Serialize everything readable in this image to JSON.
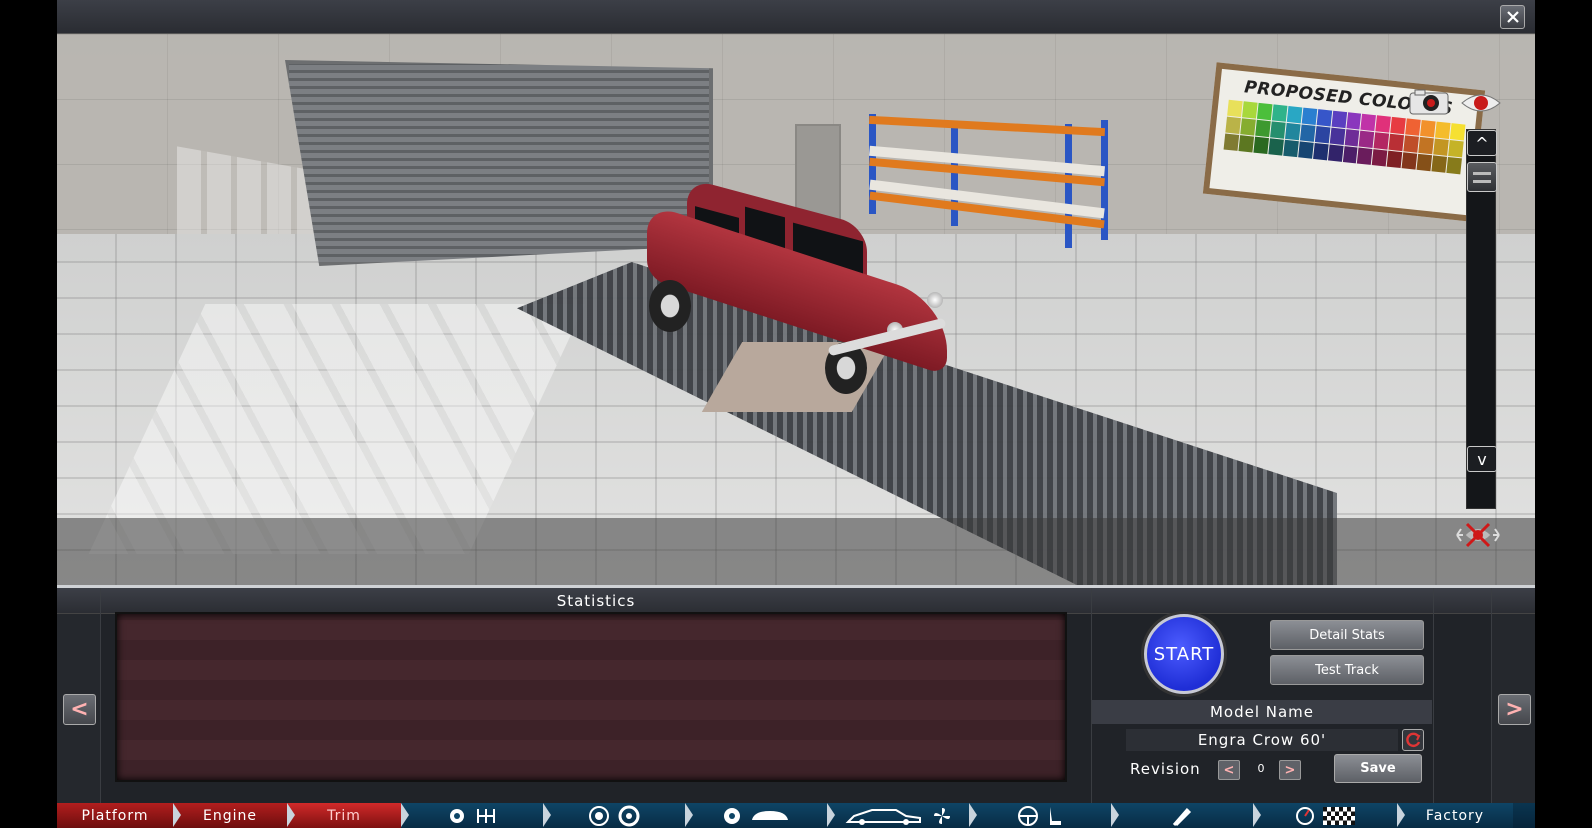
{
  "window": {
    "close_label": "✕"
  },
  "viewport": {
    "colour_board_title": "PROPOSED COLOURS",
    "scroll_up_label": "^",
    "scroll_down_label": "v",
    "swatch_colors": [
      "#e8e05a",
      "#a8d83c",
      "#4cbf3b",
      "#2fb38a",
      "#29a7c4",
      "#2a7fd0",
      "#3756c9",
      "#5a3fc0",
      "#8a37bd",
      "#c033a8",
      "#e0317a",
      "#e73b42",
      "#ef6233",
      "#f2912c",
      "#f4bc2c",
      "#f6e031"
    ]
  },
  "statistics": {
    "title": "Statistics"
  },
  "controls": {
    "start_label": "START",
    "detail_stats_label": "Detail Stats",
    "test_track_label": "Test Track",
    "model_name_header": "Model Name",
    "model_name_value": "Engra Crow 60'",
    "revision_label": "Revision",
    "revision_prev": "<",
    "revision_next": ">",
    "revision_value": "0",
    "save_label": "Save"
  },
  "nav": {
    "prev_label": "<",
    "next_label": ">",
    "tabs": [
      {
        "label": "Platform",
        "state": "done"
      },
      {
        "label": "Engine",
        "state": "done"
      },
      {
        "label": "Trim",
        "state": "active"
      },
      {
        "label": "",
        "icons": [
          "gear-wheel-icon",
          "gearbox-icon"
        ]
      },
      {
        "label": "",
        "icons": [
          "wheel-icon",
          "tire-icon"
        ]
      },
      {
        "label": "",
        "icons": [
          "brake-disc-icon",
          "body-panel-icon"
        ]
      },
      {
        "label": "",
        "icons": [
          "car-body-icon",
          "fan-icon"
        ]
      },
      {
        "label": "",
        "icons": [
          "steering-wheel-icon",
          "seat-icon"
        ]
      },
      {
        "label": "",
        "icons": [
          "tools-icon"
        ]
      },
      {
        "label": "",
        "icons": [
          "gauge-icon",
          "checkered-flag-icon"
        ]
      },
      {
        "label": "Factory",
        "state": "pending"
      }
    ]
  },
  "colors": {
    "accent_red": "#b21e1e",
    "start_blue": "#1f2ed6",
    "nav_blue": "#0a3550"
  }
}
